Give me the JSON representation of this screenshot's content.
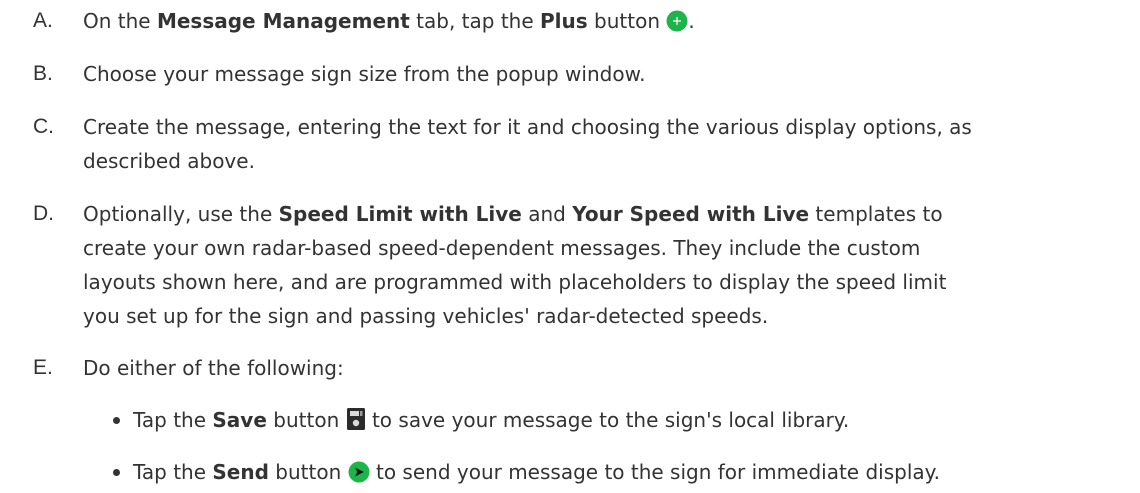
{
  "steps": [
    {
      "marker": "A.",
      "parts": [
        "On the ",
        "Message Management",
        " tab, tap the ",
        "Plus",
        " button ",
        "."
      ],
      "icon": "plus-icon"
    },
    {
      "marker": "B.",
      "text": "Choose your message sign size from the popup window."
    },
    {
      "marker": "C.",
      "line1": "Create the message, entering the text for it and choosing the various display options, as",
      "line2": "described above."
    },
    {
      "marker": "D.",
      "parts": [
        "Optionally, use the ",
        "Speed Limit with Live",
        " and ",
        "Your Speed with Live",
        " templates to"
      ],
      "line2": "create your own radar-based speed-dependent messages. They include the custom",
      "line3": "layouts shown here, and are programmed with placeholders to display the speed limit",
      "line4": "you set up for the sign and passing vehicles' radar-detected speeds."
    },
    {
      "marker": "E.",
      "text": "Do either of the following:",
      "bullets": [
        {
          "parts": [
            "Tap the ",
            "Save",
            " button ",
            " to save your message to the sign's local library."
          ],
          "icon": "save-icon"
        },
        {
          "parts": [
            "Tap the ",
            "Send",
            " button ",
            " to send your message to the sign for immediate display."
          ],
          "icon": "send-icon"
        }
      ]
    }
  ],
  "colors": {
    "text": "#333333",
    "plus_icon": "#1db44b",
    "send_icon": "#1db44b",
    "save_icon": "#2b2b2b"
  }
}
